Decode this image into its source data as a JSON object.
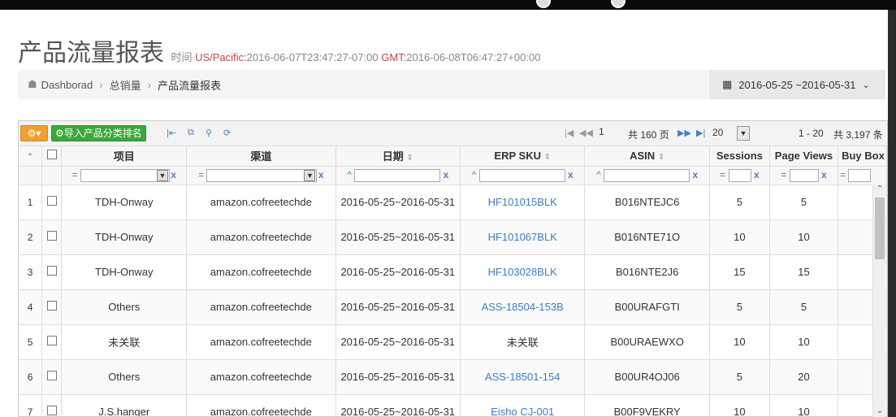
{
  "page": {
    "title": "产品流量报表",
    "time_label": "时间",
    "tz1_label": "US/Pacific:",
    "tz1_value": "2016-06-07T23:47:27-07:00",
    "tz2_label": "GMT:",
    "tz2_value": "2016-06-08T06:47:27+00:00"
  },
  "breadcrumb": {
    "home": "Dashborad",
    "parent": "总销量",
    "current": "产品流量报表"
  },
  "daterange": {
    "label": "2016-05-25 ~2016-05-31"
  },
  "toolbar": {
    "import_label": "导入产品分类排名",
    "page_current": "1",
    "page_total": "共 160 页",
    "page_size": "20",
    "range_text": "1 - 20",
    "total_text": "共 3,197 条"
  },
  "columns": {
    "item": "项目",
    "channel": "渠道",
    "date": "日期",
    "sku": "ERP SKU",
    "asin": "ASIN",
    "sessions": "Sessions",
    "pageviews": "Page Views",
    "buybox": "Buy Box"
  },
  "rows": [
    {
      "no": "1",
      "item": "TDH-Onway",
      "channel": "amazon.cofreetechde",
      "date": "2016-05-25~2016-05-31",
      "sku": "HF101015BLK",
      "sku_link": true,
      "asin": "B016NTEJC6",
      "sessions": "5",
      "pageviews": "5"
    },
    {
      "no": "2",
      "item": "TDH-Onway",
      "channel": "amazon.cofreetechde",
      "date": "2016-05-25~2016-05-31",
      "sku": "HF101067BLK",
      "sku_link": true,
      "asin": "B016NTE71O",
      "sessions": "10",
      "pageviews": "10"
    },
    {
      "no": "3",
      "item": "TDH-Onway",
      "channel": "amazon.cofreetechde",
      "date": "2016-05-25~2016-05-31",
      "sku": "HF103028BLK",
      "sku_link": true,
      "asin": "B016NTE2J6",
      "sessions": "15",
      "pageviews": "15"
    },
    {
      "no": "4",
      "item": "Others",
      "channel": "amazon.cofreetechde",
      "date": "2016-05-25~2016-05-31",
      "sku": "ASS-18504-153B",
      "sku_link": true,
      "asin": "B00URAFGTI",
      "sessions": "5",
      "pageviews": "5"
    },
    {
      "no": "5",
      "item": "未关联",
      "channel": "amazon.cofreetechde",
      "date": "2016-05-25~2016-05-31",
      "sku": "未关联",
      "sku_link": false,
      "asin": "B00URAEWXO",
      "sessions": "10",
      "pageviews": "10"
    },
    {
      "no": "6",
      "item": "Others",
      "channel": "amazon.cofreetechde",
      "date": "2016-05-25~2016-05-31",
      "sku": "ASS-18501-154",
      "sku_link": true,
      "asin": "B00UR4OJ06",
      "sessions": "5",
      "pageviews": "20"
    },
    {
      "no": "7",
      "item": "J.S.hanger",
      "channel": "amazon.cofreetechde",
      "date": "2016-05-25~2016-05-31",
      "sku": "Eisho CJ-001",
      "sku_link": true,
      "asin": "B00F9VEKRY",
      "sessions": "10",
      "pageviews": "10"
    }
  ]
}
